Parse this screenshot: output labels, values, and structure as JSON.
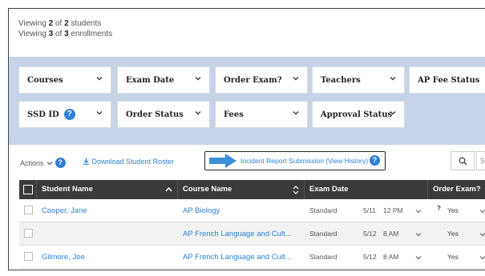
{
  "summary": {
    "students_prefix": "Viewing ",
    "students_count": "2",
    "students_mid": " of ",
    "students_total": "2",
    "students_suffix": " students",
    "enroll_prefix": "Viewing ",
    "enroll_count": "3",
    "enroll_mid": " of ",
    "enroll_total": "3",
    "enroll_suffix": " enrollments"
  },
  "filters": {
    "courses": "Courses",
    "exam_date": "Exam Date",
    "order_exam": "Order Exam?",
    "teachers": "Teachers",
    "ap_fee_status": "AP Fee Status",
    "ssd_id": "SSD ID",
    "order_status": "Order Status",
    "fees": "Fees",
    "approval_status": "Approval Status"
  },
  "toolbar": {
    "actions": "Actions",
    "download_roster": "Download Student Roster",
    "incident_report": "Incident Report Submission (View History)",
    "search_tail": "S"
  },
  "table": {
    "headers": {
      "student_name": "Student Name",
      "course_name": "Course Name",
      "exam_date": "Exam Date",
      "order_exam": "Order Exam?"
    },
    "rows": [
      {
        "student": "Cooper, Jane",
        "course": "AP Biology",
        "exam_type": "Standard",
        "exam_date": "5/11",
        "exam_time": "12 PM",
        "order_exam": "Yes"
      },
      {
        "student": "",
        "course": "AP French Language and Cult...",
        "exam_type": "Standard",
        "exam_date": "5/12",
        "exam_time": "8 AM",
        "order_exam": "Yes"
      },
      {
        "student": "Gilmore, Joe",
        "course": "AP French Language and Cult...",
        "exam_type": "Standard",
        "exam_date": "5/12",
        "exam_time": "8 AM",
        "order_exam": "Yes"
      }
    ]
  },
  "colors": {
    "accent": "#2f7fd6",
    "filter_band": "#c7d3e6",
    "header_bg": "#3a3a3a",
    "arrow": "#3b8fd9"
  }
}
